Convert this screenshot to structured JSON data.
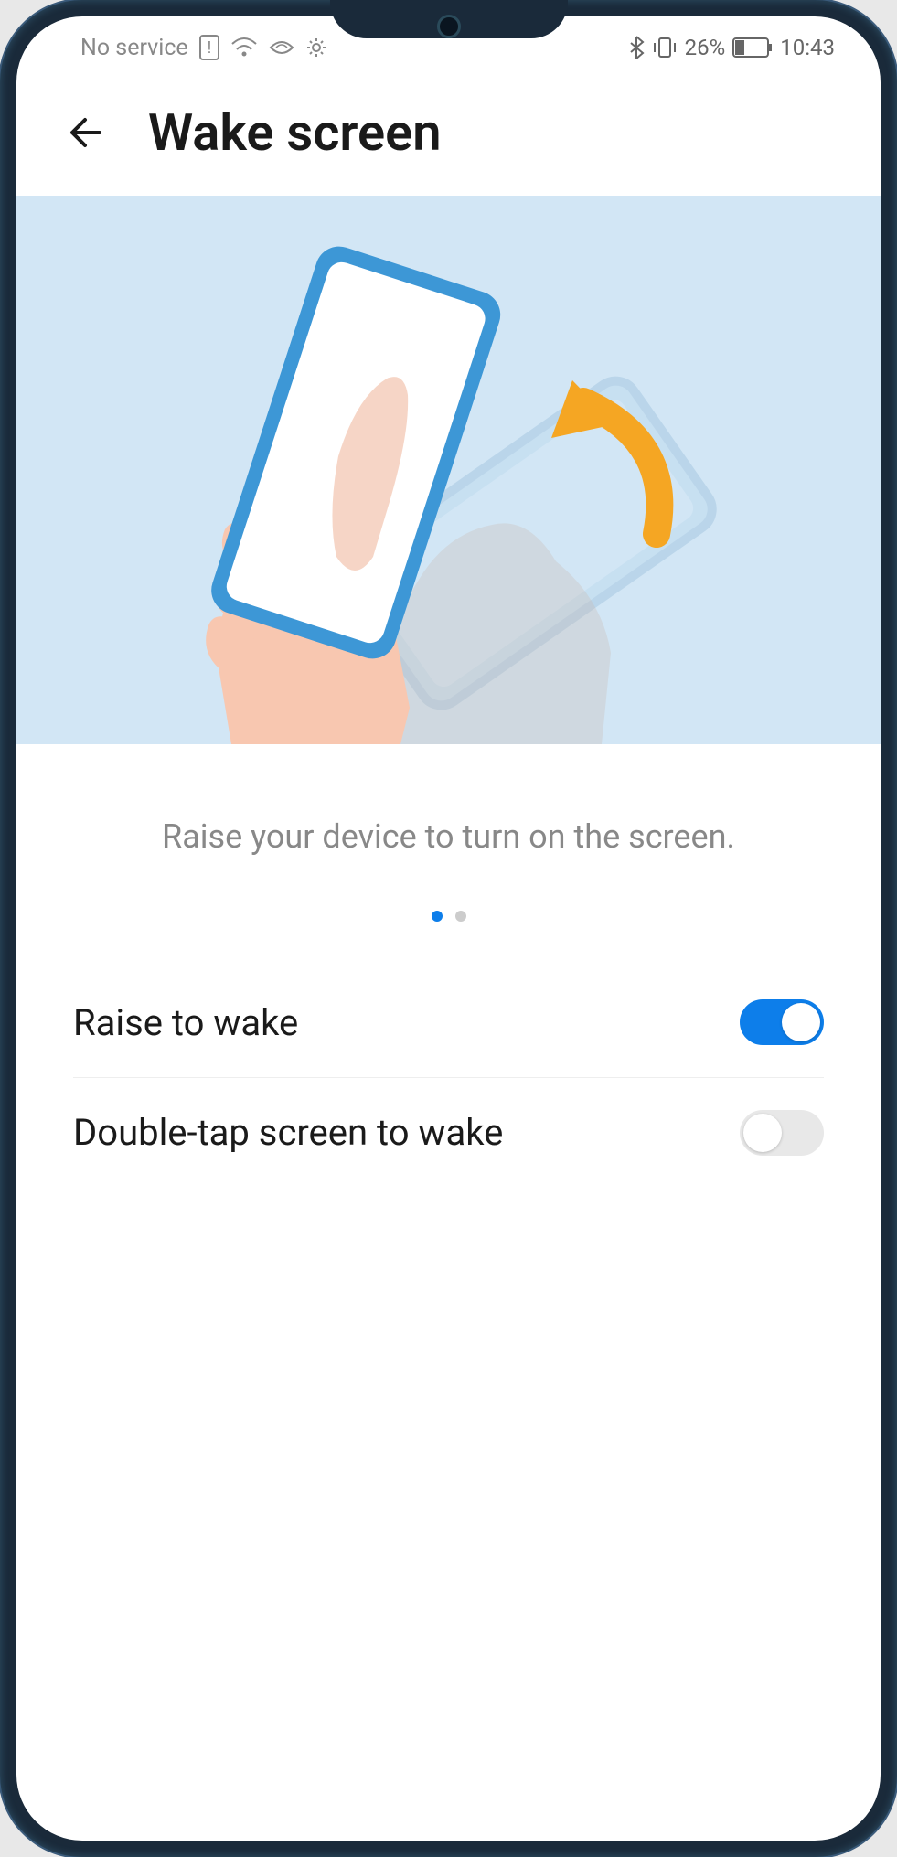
{
  "status_bar": {
    "service_text": "No service",
    "battery_percent": "26%",
    "time": "10:43",
    "icons": {
      "sim_alert": "sim-alert-icon",
      "wifi": "wifi-icon",
      "signal": "signal-icon",
      "settings": "gear-icon",
      "bluetooth": "bluetooth-icon",
      "vibrate": "vibrate-icon"
    }
  },
  "header": {
    "title": "Wake screen"
  },
  "illustration": {
    "caption": "Raise your device to turn on the screen."
  },
  "page_indicator": {
    "count": 2,
    "active": 0
  },
  "settings": [
    {
      "label": "Raise to wake",
      "enabled": true
    },
    {
      "label": "Double-tap screen to wake",
      "enabled": false
    }
  ]
}
